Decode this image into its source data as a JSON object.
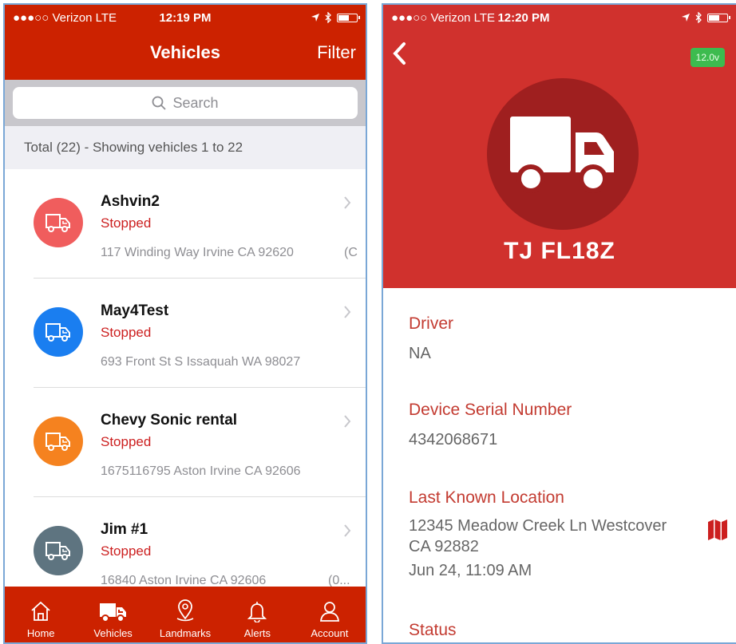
{
  "left": {
    "status": {
      "carrier": "●●●○○ Verizon  LTE",
      "time": "12:19 PM"
    },
    "nav": {
      "title": "Vehicles",
      "filter": "Filter"
    },
    "search": {
      "placeholder": "Search"
    },
    "total": "Total (22) - Showing vehicles 1 to 22",
    "vehicles": [
      {
        "name": "Ashvin2",
        "status": "Stopped",
        "address": "117 Winding Way Irvine CA 92620",
        "extra": "(C",
        "color": "#f05d5d"
      },
      {
        "name": "May4Test",
        "status": "Stopped",
        "address": "693 Front St S Issaquah WA 98027",
        "extra": "",
        "color": "#1a7ef0"
      },
      {
        "name": "Chevy Sonic rental",
        "status": "Stopped",
        "address": "1675116795 Aston Irvine CA 92606",
        "extra": "",
        "color": "#f5821f"
      },
      {
        "name": "Jim #1",
        "status": "Stopped",
        "address": "16840 Aston Irvine CA 92606",
        "extra": "(0...",
        "color": "#5e7480"
      }
    ],
    "tabs": [
      {
        "label": "Home",
        "icon": "home-icon"
      },
      {
        "label": "Vehicles",
        "icon": "truck-icon"
      },
      {
        "label": "Landmarks",
        "icon": "location-pin-icon"
      },
      {
        "label": "Alerts",
        "icon": "bell-icon"
      },
      {
        "label": "Account",
        "icon": "user-icon"
      }
    ],
    "colors": {
      "brand": "#cc2200",
      "status": "#cc1f1f"
    }
  },
  "right": {
    "status": {
      "carrier": "●●●○○ Verizon  LTE",
      "time": "12:20 PM"
    },
    "voltage": "12.0v",
    "plate": "TJ FL18Z",
    "fields": [
      {
        "label": "Driver",
        "value": "NA"
      },
      {
        "label": "Device Serial Number",
        "value": "4342068671"
      },
      {
        "label": "Last Known Location",
        "value": "12345 Meadow Creek Ln Westcover",
        "value2": "CA 92882",
        "value3": "Jun 24, 11:09 AM"
      },
      {
        "label": "Status",
        "value": ""
      }
    ],
    "colors": {
      "hero": "#d0312d",
      "circle": "#9f1f1f",
      "label": "#c33b31",
      "voltage": "#3dbb4f"
    }
  }
}
